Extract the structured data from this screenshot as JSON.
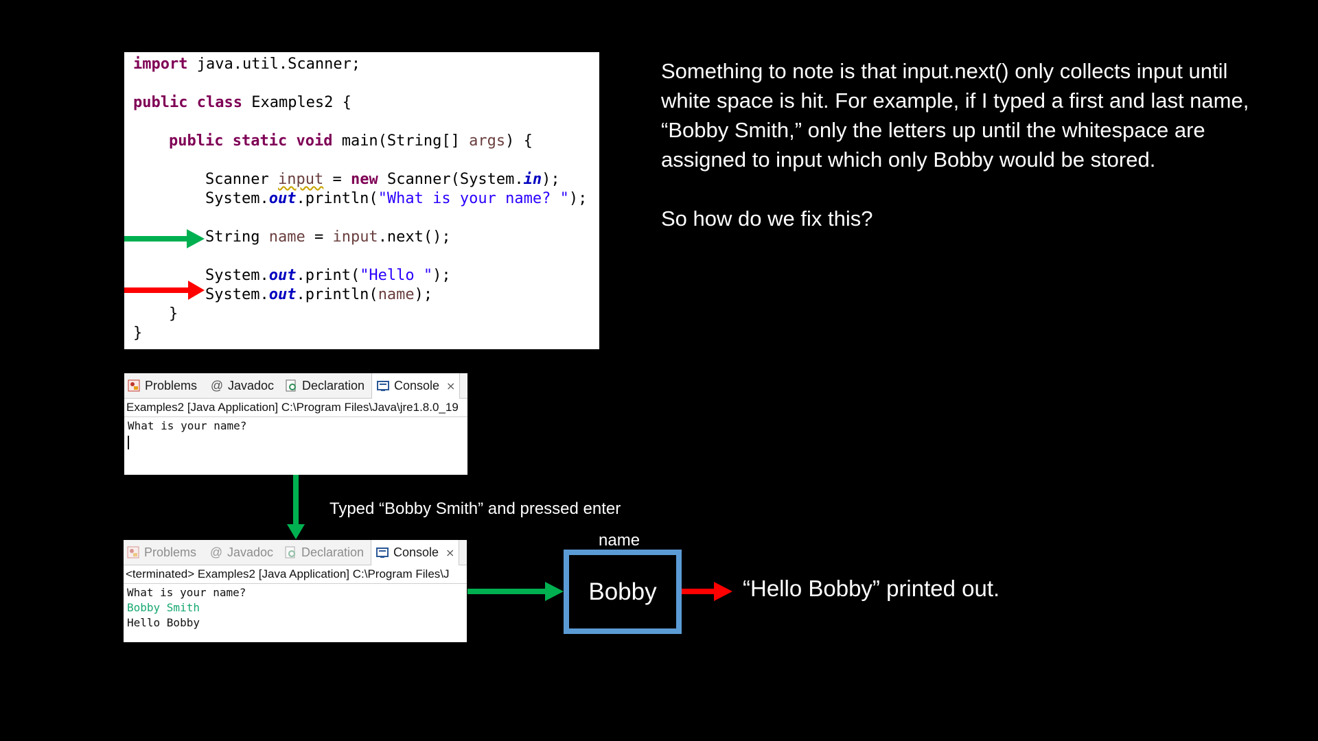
{
  "code": {
    "line1": {
      "kw": "import",
      "rest": " java.util.Scanner;"
    },
    "line2": {
      "kw1": "public",
      "kw2": "class",
      "rest": " Examples2 {"
    },
    "line3": {
      "kw1": "public",
      "kw2": "static",
      "kw3": "void",
      "mid": " main(String[] ",
      "param": "args",
      "end": ") {"
    },
    "line4": {
      "a": "Scanner ",
      "var": "input",
      "b": " = ",
      "kw": "new",
      "c": " Scanner(System.",
      "fld": "in",
      "d": ");"
    },
    "line5": {
      "a": "System.",
      "fld": "out",
      "b": ".println(",
      "str": "\"What is your name? \"",
      "c": ");"
    },
    "line6": {
      "a": "String ",
      "var": "name",
      "b": " = ",
      "var2": "input",
      "c": ".next();"
    },
    "line7": {
      "a": "System.",
      "fld": "out",
      "b": ".print(",
      "str": "\"Hello \"",
      "c": ");"
    },
    "line8": {
      "a": "System.",
      "fld": "out",
      "b": ".println(",
      "var": "name",
      "c": ");"
    },
    "line9": "}",
    "line10": "}"
  },
  "console_before": {
    "tabs": [
      "Problems",
      "Javadoc",
      "Declaration",
      "Console"
    ],
    "launch": "Examples2 [Java Application] C:\\Program Files\\Java\\jre1.8.0_19",
    "output": [
      "What is your name?"
    ]
  },
  "console_after": {
    "tabs": [
      "Problems",
      "Javadoc",
      "Declaration",
      "Console"
    ],
    "launch": "<terminated> Examples2 [Java Application] C:\\Program Files\\J",
    "output": [
      "What is your name?",
      "Bobby Smith",
      "Hello Bobby"
    ]
  },
  "explanation": {
    "paragraph1": "Something to note is that input.next() only collects input until white space is hit. For example, if I typed a first and last name, “Bobby Smith,” only the letters up until the whitespace are assigned to input which only Bobby would be stored.",
    "paragraph2": "So how do we fix this?"
  },
  "typed_note": "Typed “Bobby Smith” and pressed enter",
  "variable": {
    "label": "name",
    "value": "Bobby"
  },
  "result_note": "“Hello Bobby” printed out.",
  "colors": {
    "green_arrow": "#00b050",
    "red_arrow": "#ff0000",
    "box_border": "#5b9bd5",
    "keyword": "#7f0055",
    "string": "#2a00ff"
  },
  "icons": [
    "problems-icon",
    "javadoc-icon",
    "declaration-icon",
    "console-icon",
    "close-icon"
  ]
}
